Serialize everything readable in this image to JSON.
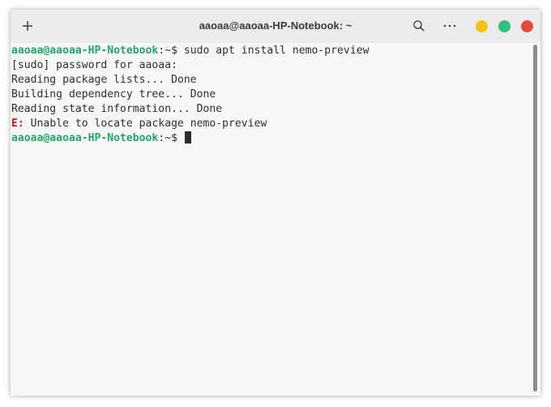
{
  "window": {
    "title": "aaoaa@aaoaa-HP-Notebook: ~"
  },
  "icons": {
    "new_tab": "plus-icon",
    "search": "search-icon",
    "more": "more-horizontal-icon"
  },
  "controls": {
    "minimize_color": "#f5c211",
    "maximize_color": "#2ec27e",
    "close_color": "#e5483f"
  },
  "terminal": {
    "prompt_user": "aaoaa@aaoaa-HP-Notebook",
    "prompt_suffix": ":~$ ",
    "command": "sudo apt install nemo-preview",
    "output": [
      "[sudo] password for aaoaa:",
      "Reading package lists... Done",
      "Building dependency tree... Done",
      "Reading state information... Done"
    ],
    "error_prefix": "E:",
    "error_message": " Unable to locate package nemo-preview",
    "prompt_user_2": "aaoaa@aaoaa-HP-Notebook",
    "prompt_suffix_2": ":~$ "
  }
}
